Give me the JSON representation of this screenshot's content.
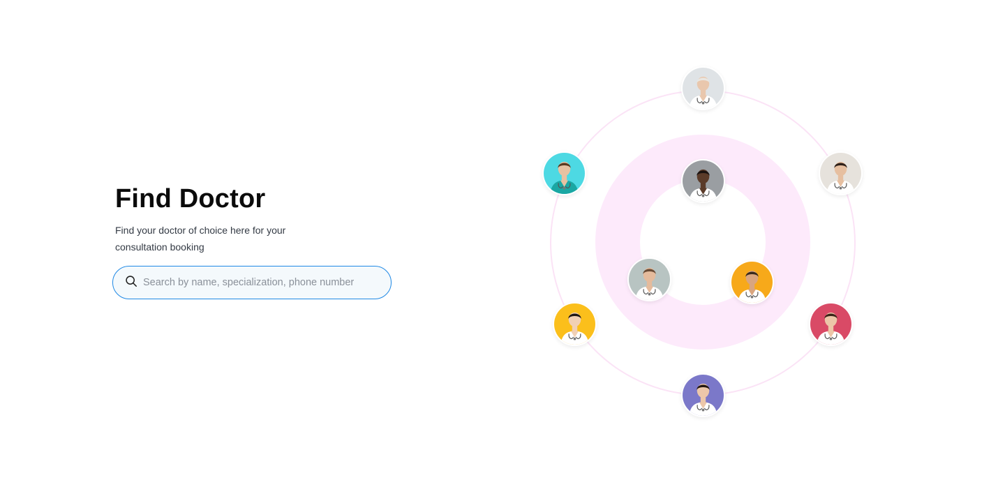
{
  "hero": {
    "title": "Find Doctor",
    "subtitle": "Find your doctor of choice here for your consultation booking"
  },
  "search": {
    "placeholder": "Search by name, specialization, phone number",
    "value": "",
    "icon": "search-icon"
  },
  "doctors": [
    {
      "id": "top",
      "bg": "#dfe3e6",
      "skin": "#e9c7ad",
      "hair": "#e9e6e1",
      "coat": "#ffffff"
    },
    {
      "id": "left-upper",
      "bg": "#4dd9e3",
      "skin": "#e8c2a2",
      "hair": "#5a3b22",
      "coat": "#1aa7a3"
    },
    {
      "id": "right-upper",
      "bg": "#e6e2dc",
      "skin": "#e6bfa0",
      "hair": "#2e2019",
      "coat": "#ffffff"
    },
    {
      "id": "center-top",
      "bg": "#9a9ea2",
      "skin": "#5b3b29",
      "hair": "#1a1210",
      "coat": "#ffffff"
    },
    {
      "id": "center-left",
      "bg": "#b8c4c2",
      "skin": "#e5bb9c",
      "hair": "#6b4c36",
      "coat": "#ffffff"
    },
    {
      "id": "center-right",
      "bg": "#f7a91a",
      "skin": "#d9a57f",
      "hair": "#3a2a1c",
      "coat": "#ffffff"
    },
    {
      "id": "left-lower",
      "bg": "#fbbf1b",
      "skin": "#f1d0b5",
      "hair": "#1f1712",
      "coat": "#ffffff"
    },
    {
      "id": "right-lower",
      "bg": "#d94a66",
      "skin": "#ecc6a8",
      "hair": "#3b2418",
      "coat": "#ffffff"
    },
    {
      "id": "bottom",
      "bg": "#7b78c9",
      "skin": "#ecc7aa",
      "hair": "#231812",
      "coat": "#ffffff"
    }
  ],
  "colors": {
    "accent": "#1e88e5",
    "ring_outer": "#fbe3f6",
    "ring_inner": "#fdeafb"
  }
}
